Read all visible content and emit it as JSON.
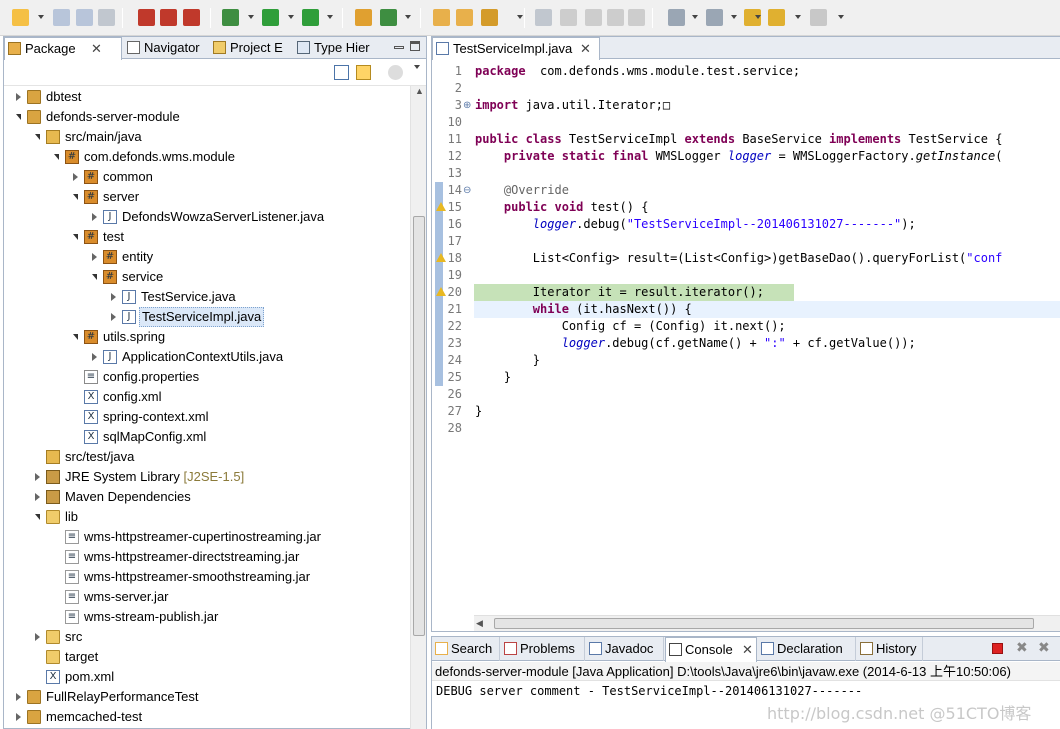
{
  "toolbar": {
    "icons": [
      "new-icon",
      "save-icon",
      "save-all-icon",
      "print-icon",
      "debug-icon",
      "debug-stop-icon",
      "debug-step-icon",
      "debug-run-icon",
      "run-icon",
      "external-tools-icon",
      "new-package-icon",
      "new-class-icon",
      "open-type-icon",
      "open-resource-icon",
      "search-icon",
      "annotation-icon",
      "pen-icon",
      "toggle-icon",
      "block-icon",
      "show-whitespace-icon",
      "next-annotation-icon",
      "prev-annotation-icon",
      "last-edit-icon",
      "back-icon",
      "forward-icon"
    ]
  },
  "left_panel": {
    "tabs": [
      {
        "label": "Package",
        "active": true
      },
      {
        "label": "Navigator",
        "active": false
      },
      {
        "label": "Project E",
        "active": false
      },
      {
        "label": "Type Hier",
        "active": false
      }
    ],
    "tree": [
      {
        "label": "dbtest",
        "icon": "project-icon",
        "state": "collapsed",
        "depth": 0
      },
      {
        "label": "defonds-server-module",
        "icon": "project-icon",
        "state": "expanded",
        "depth": 0
      },
      {
        "label": "src/main/java",
        "icon": "source-folder-icon",
        "state": "expanded",
        "depth": 1
      },
      {
        "label": "com.defonds.wms.module",
        "icon": "package-icon",
        "state": "expanded",
        "depth": 2
      },
      {
        "label": "common",
        "icon": "package-icon",
        "state": "collapsed",
        "depth": 3
      },
      {
        "label": "server",
        "icon": "package-icon",
        "state": "expanded",
        "depth": 3
      },
      {
        "label": "DefondsWowzaServerListener.java",
        "icon": "java-file-icon",
        "state": "collapsed",
        "depth": 4
      },
      {
        "label": "test",
        "icon": "package-icon",
        "state": "expanded",
        "depth": 3
      },
      {
        "label": "entity",
        "icon": "package-icon",
        "state": "collapsed",
        "depth": 4
      },
      {
        "label": "service",
        "icon": "package-icon",
        "state": "expanded",
        "depth": 4
      },
      {
        "label": "TestService.java",
        "icon": "java-file-icon",
        "state": "collapsed",
        "depth": 5
      },
      {
        "label": "TestServiceImpl.java",
        "icon": "java-file-icon",
        "state": "collapsed",
        "depth": 5,
        "selected": true
      },
      {
        "label": "utils.spring",
        "icon": "package-icon",
        "state": "expanded",
        "depth": 3
      },
      {
        "label": "ApplicationContextUtils.java",
        "icon": "java-file-icon",
        "state": "collapsed",
        "depth": 4
      },
      {
        "label": "config.properties",
        "icon": "properties-file-icon",
        "state": "none",
        "depth": 3
      },
      {
        "label": "config.xml",
        "icon": "xml-file-icon",
        "state": "none",
        "depth": 3
      },
      {
        "label": "spring-context.xml",
        "icon": "xml-file-icon",
        "state": "none",
        "depth": 3
      },
      {
        "label": "sqlMapConfig.xml",
        "icon": "xml-file-icon",
        "state": "none",
        "depth": 3
      },
      {
        "label": "src/test/java",
        "icon": "source-folder-icon",
        "state": "none",
        "depth": 1
      },
      {
        "label": "JRE System Library",
        "suffix": "[J2SE-1.5]",
        "icon": "library-icon",
        "state": "collapsed",
        "depth": 1
      },
      {
        "label": "Maven Dependencies",
        "icon": "library-icon",
        "state": "collapsed",
        "depth": 1
      },
      {
        "label": "lib",
        "icon": "folder-icon",
        "state": "expanded",
        "depth": 1
      },
      {
        "label": "wms-httpstreamer-cupertinostreaming.jar",
        "icon": "jar-file-icon",
        "state": "none",
        "depth": 2
      },
      {
        "label": "wms-httpstreamer-directstreaming.jar",
        "icon": "jar-file-icon",
        "state": "none",
        "depth": 2
      },
      {
        "label": "wms-httpstreamer-smoothstreaming.jar",
        "icon": "jar-file-icon",
        "state": "none",
        "depth": 2
      },
      {
        "label": "wms-server.jar",
        "icon": "jar-file-icon",
        "state": "none",
        "depth": 2
      },
      {
        "label": "wms-stream-publish.jar",
        "icon": "jar-file-icon",
        "state": "none",
        "depth": 2
      },
      {
        "label": "src",
        "icon": "folder-icon",
        "state": "collapsed",
        "depth": 1
      },
      {
        "label": "target",
        "icon": "folder-icon",
        "state": "none",
        "depth": 1
      },
      {
        "label": "pom.xml",
        "icon": "xml-file-icon",
        "state": "none",
        "depth": 1
      },
      {
        "label": "FullRelayPerformanceTest",
        "icon": "project-icon",
        "state": "collapsed",
        "depth": 0
      },
      {
        "label": "memcached-test",
        "icon": "project-icon",
        "state": "collapsed",
        "depth": 0
      }
    ]
  },
  "editor": {
    "tab_label": "TestServiceImpl.java",
    "line_numbers": [
      "1",
      "2",
      "3",
      "10",
      "11",
      "12",
      "13",
      "14",
      "15",
      "16",
      "17",
      "18",
      "19",
      "20",
      "21",
      "22",
      "23",
      "24",
      "25",
      "26",
      "27",
      "28"
    ],
    "highlighted_line": "20",
    "cursor_line": "21",
    "lines": [
      [
        [
          "kw",
          "package"
        ],
        [
          "",
          "  com.defonds.wms.module.test.service;"
        ]
      ],
      [],
      [
        [
          "kw",
          "import"
        ],
        [
          "",
          " java.util.Iterator;"
        ],
        [
          "",
          "□"
        ]
      ],
      [],
      [
        [
          "kw",
          "public class"
        ],
        [
          "",
          " TestServiceImpl "
        ],
        [
          "kw",
          "extends"
        ],
        [
          "",
          " BaseService "
        ],
        [
          "kw",
          "implements"
        ],
        [
          "",
          " TestService {"
        ]
      ],
      [
        [
          "",
          "    "
        ],
        [
          "kw",
          "private static final"
        ],
        [
          "",
          " WMSLogger "
        ],
        [
          "fld",
          "logger"
        ],
        [
          "",
          " = WMSLoggerFactory."
        ],
        [
          "itl2",
          "getInstance"
        ],
        [
          "",
          "("
        ]
      ],
      [],
      [
        [
          "ann",
          "    @Override"
        ]
      ],
      [
        [
          "",
          "    "
        ],
        [
          "kw",
          "public void"
        ],
        [
          "",
          " test() {"
        ]
      ],
      [
        [
          "",
          "        "
        ],
        [
          "fld",
          "logger"
        ],
        [
          "",
          ".debug("
        ],
        [
          "str",
          "\"TestServiceImpl--201406131027-------\""
        ],
        [
          "",
          ");"
        ]
      ],
      [],
      [
        [
          "",
          "        List<Config> result=(List<Config>)getBaseDao().queryForList("
        ],
        [
          "str",
          "\"conf"
        ]
      ],
      [],
      [
        [
          "",
          "        Iterator it = result.iterator();"
        ]
      ],
      [
        [
          "",
          "        "
        ],
        [
          "kw",
          "while"
        ],
        [
          "",
          " (it.hasNext()) {"
        ]
      ],
      [
        [
          "",
          "            Config cf = (Config) it.next();"
        ]
      ],
      [
        [
          "",
          "            "
        ],
        [
          "fld",
          "logger"
        ],
        [
          "",
          ".debug(cf.getName() + "
        ],
        [
          "str",
          "\":\""
        ],
        [
          "",
          " + cf.getValue());"
        ]
      ],
      [
        [
          "",
          "        }"
        ]
      ],
      [
        [
          "",
          "    }"
        ]
      ],
      [],
      [
        [
          "",
          "}"
        ]
      ],
      []
    ]
  },
  "console": {
    "tabs": [
      {
        "label": "Search",
        "icon": "search-icon"
      },
      {
        "label": "Problems",
        "icon": "problems-icon"
      },
      {
        "label": "Javadoc",
        "icon": "javadoc-icon"
      },
      {
        "label": "Console",
        "icon": "console-icon",
        "active": true
      },
      {
        "label": "Declaration",
        "icon": "declaration-icon"
      },
      {
        "label": "History",
        "icon": "history-icon"
      }
    ],
    "header": "defonds-server-module [Java Application] D:\\tools\\Java\\jre6\\bin\\javaw.exe (2014-6-13 上午10:50:06)",
    "output": "DEBUG server comment - TestServiceImpl--201406131027-------"
  },
  "watermark": "http://blog.csdn.net @51CTO博客",
  "colors": {
    "keyword": "#7f0055",
    "string": "#2a00ff",
    "field": "#0000c0",
    "highlight_line": "#c6e2b8",
    "cursor_line": "#e8f2fe",
    "selection": "#dbe8f8"
  }
}
